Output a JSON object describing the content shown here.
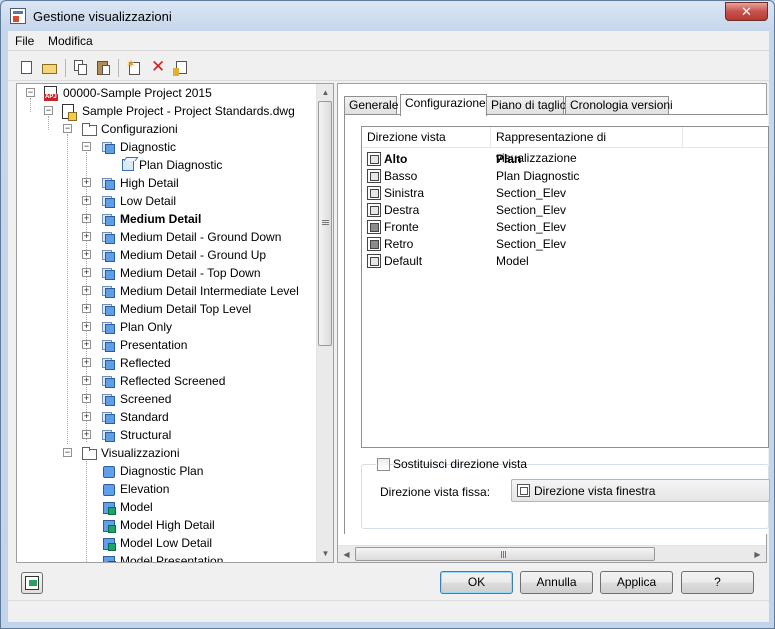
{
  "window": {
    "title": "Gestione visualizzazioni",
    "close_glyph": "✕"
  },
  "menu": {
    "items": [
      "File",
      "Modifica"
    ]
  },
  "toolbar": {
    "icons": [
      "new-icon",
      "open-icon",
      "copy-icon",
      "paste-icon",
      "new-configuration-icon",
      "delete-icon",
      "purge-icon"
    ]
  },
  "tree": {
    "project": "00000-Sample Project 2015",
    "drawing": "Sample Project - Project Standards.dwg",
    "configurations_folder": "Configurazioni",
    "configurations": [
      {
        "label": "Diagnostic",
        "bold": false
      },
      {
        "label": "High Detail",
        "bold": false
      },
      {
        "label": "Low Detail",
        "bold": false
      },
      {
        "label": "Medium Detail",
        "bold": true
      },
      {
        "label": "Medium Detail - Ground Down",
        "bold": false
      },
      {
        "label": "Medium Detail - Ground Up",
        "bold": false
      },
      {
        "label": "Medium Detail - Top Down",
        "bold": false
      },
      {
        "label": "Medium Detail Intermediate Level",
        "bold": false
      },
      {
        "label": "Medium Detail Top Level",
        "bold": false
      },
      {
        "label": "Plan Only",
        "bold": false
      },
      {
        "label": "Presentation",
        "bold": false
      },
      {
        "label": "Reflected",
        "bold": false
      },
      {
        "label": "Reflected Screened",
        "bold": false
      },
      {
        "label": "Screened",
        "bold": false
      },
      {
        "label": "Standard",
        "bold": false
      },
      {
        "label": "Structural",
        "bold": false
      }
    ],
    "diagnostic_child": "Plan Diagnostic",
    "displays_folder": "Visualizzazioni",
    "displays": [
      {
        "label": "Diagnostic Plan",
        "icon": "display-icon"
      },
      {
        "label": "Elevation",
        "icon": "display-icon"
      },
      {
        "label": "Model",
        "icon": "display-model-icon"
      },
      {
        "label": "Model High Detail",
        "icon": "display-model-icon"
      },
      {
        "label": "Model Low Detail",
        "icon": "display-model-icon"
      },
      {
        "label": "Model Presentation",
        "icon": "display-model-icon"
      }
    ]
  },
  "tabs": [
    "Generale",
    "Configurazione",
    "Piano di taglio",
    "Cronologia versioni"
  ],
  "active_tab": "Configurazione",
  "listview": {
    "columns": [
      "Direzione vista",
      "Rappresentazione di visualizzazione"
    ],
    "rows": [
      {
        "direction": "Alto",
        "representation": "Plan",
        "bold": true
      },
      {
        "direction": "Basso",
        "representation": "Plan Diagnostic",
        "bold": false
      },
      {
        "direction": "Sinistra",
        "representation": "Section_Elev",
        "bold": false
      },
      {
        "direction": "Destra",
        "representation": "Section_Elev",
        "bold": false
      },
      {
        "direction": "Fronte",
        "representation": "Section_Elev",
        "bold": false
      },
      {
        "direction": "Retro",
        "representation": "Section_Elev",
        "bold": false
      },
      {
        "direction": "Default",
        "representation": "Model",
        "bold": false
      }
    ]
  },
  "override": {
    "checkbox_label": "Sostituisci direzione vista",
    "checked": false,
    "fixed_label": "Direzione vista fissa:",
    "fixed_value": "Direzione vista finestra"
  },
  "buttons": {
    "ok": "OK",
    "cancel": "Annulla",
    "apply": "Applica",
    "help": "?"
  },
  "scroll_glyphs": {
    "up": "▲",
    "down": "▼",
    "left": "◀",
    "right": "▶"
  },
  "tree_glyphs": {
    "collapse": "−",
    "expand": "+"
  },
  "colors": {
    "accent_blue": "#5fa0ea",
    "title_close_red": "#c75050",
    "project_red": "#c82626"
  }
}
